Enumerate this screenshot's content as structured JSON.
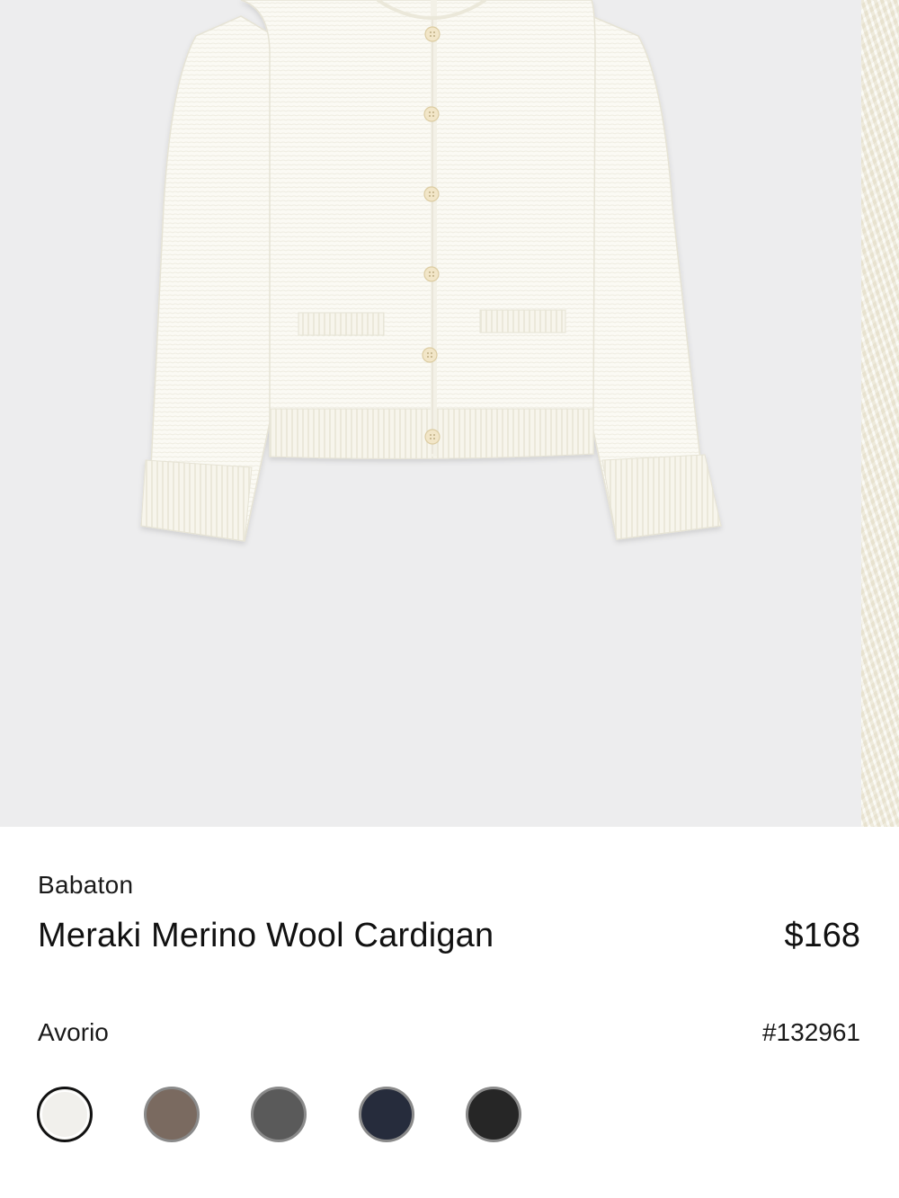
{
  "product": {
    "brand": "Babaton",
    "title": "Meraki Merino Wool Cardigan",
    "price": "$168",
    "selected_color": "Avorio",
    "style_number": "#132961",
    "image_alt": "Meraki Merino Wool Cardigan in Avorio"
  },
  "swatches": [
    {
      "name": "Avorio",
      "color": "#f1f0ec",
      "selected": true
    },
    {
      "name": "Taupe",
      "color": "#7a6a60",
      "selected": false
    },
    {
      "name": "Heather Grey",
      "color": "#5a5a5a",
      "selected": false
    },
    {
      "name": "Navy",
      "color": "#262c3c",
      "selected": false
    },
    {
      "name": "Black",
      "color": "#262626",
      "selected": false
    }
  ]
}
